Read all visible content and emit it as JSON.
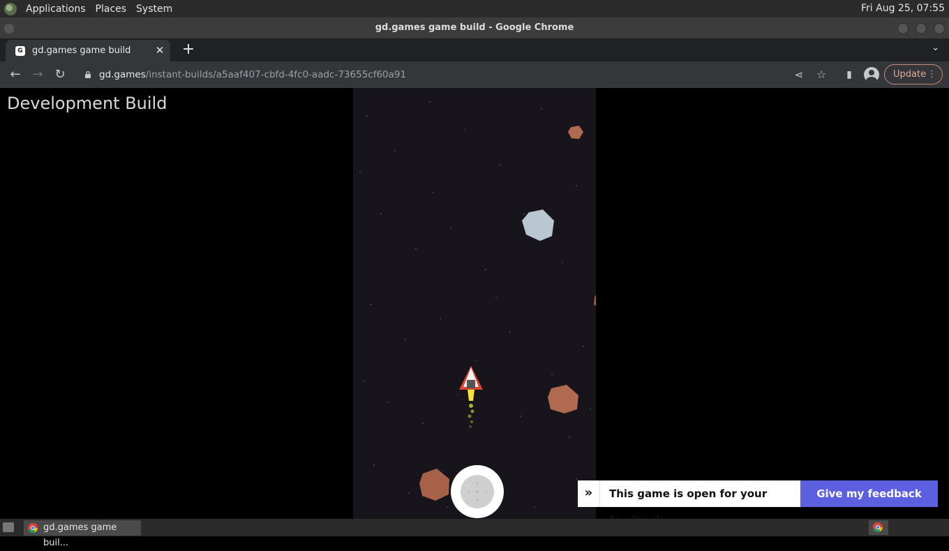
{
  "top_panel": {
    "menus": [
      "Applications",
      "Places",
      "System"
    ],
    "clock": "Fri Aug 25, 07:55"
  },
  "window": {
    "title": "gd.games game build - Google Chrome"
  },
  "tab": {
    "title": "gd.games game build",
    "favicon_icon": "gdevelop-icon",
    "close_icon": "close-icon",
    "new_tab_icon": "plus-icon"
  },
  "address_bar": {
    "host": "gd.games",
    "path": "/instant-builds/a5aaf407-cbfd-4fc0-aadc-73655cf60a91",
    "update_label": "Update"
  },
  "page": {
    "dev_build_label": "Development Build",
    "feedback_text": "This game is open for your feedback",
    "feedback_button": "Give my feedback",
    "colors": {
      "feedback_button_bg": "#5b5fe0",
      "game_bg": "#17151b"
    }
  },
  "taskbar": {
    "task_label": "gd.games game buil..."
  }
}
